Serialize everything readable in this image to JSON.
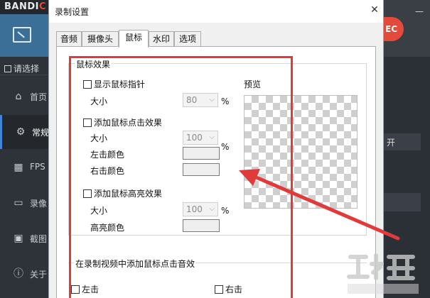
{
  "background_app": {
    "logo_text_white": "BANDI",
    "logo_text_red": "C",
    "select_label": "请选择",
    "nav": [
      {
        "label": "首页",
        "icon": "home-icon",
        "glyph": "⌂"
      },
      {
        "label": "常规",
        "icon": "gear-icon",
        "glyph": "⚙"
      },
      {
        "label": "FPS",
        "icon": "fps-icon",
        "glyph": "▦"
      },
      {
        "label": "录像",
        "icon": "video-icon",
        "glyph": "▭"
      },
      {
        "label": "截图",
        "icon": "screenshot-icon",
        "glyph": "▣"
      },
      {
        "label": "关于",
        "icon": "info-icon",
        "glyph": "ⓘ"
      }
    ],
    "rec_button_label": "EC",
    "right_button_open": "开"
  },
  "dialog": {
    "title": "录制设置",
    "close_glyph": "✕",
    "tabs": [
      {
        "label": "音频",
        "active": false
      },
      {
        "label": "摄像头",
        "active": false
      },
      {
        "label": "鼠标",
        "active": true
      },
      {
        "label": "水印",
        "active": false
      },
      {
        "label": "选项",
        "active": false
      }
    ],
    "mouse_effect": {
      "group_title": "鼠标效果",
      "show_cursor": {
        "label": "显示鼠标指针",
        "checked": false,
        "size_label": "大小",
        "size_value": "80",
        "unit": "%"
      },
      "click_effect": {
        "label": "添加鼠标点击效果",
        "checked": false,
        "size_label": "大小",
        "size_value": "100",
        "unit": "%",
        "left_color_label": "左击颜色",
        "right_color_label": "右击颜色"
      },
      "highlight_effect": {
        "label": "添加鼠标高亮效果",
        "checked": false,
        "size_label": "大小",
        "size_value": "100",
        "unit": "%",
        "color_label": "高亮颜色"
      },
      "preview_label": "预览"
    },
    "click_sound": {
      "group_title": "在录制视频中添加鼠标点击音效",
      "left_click": {
        "label": "左击",
        "checked": false
      },
      "right_click": {
        "label": "右击",
        "checked": false
      }
    }
  },
  "colors": {
    "annotation_red": "#e03a3a",
    "accent_blue": "#3f87d6",
    "rec_red": "#e24b3b"
  }
}
